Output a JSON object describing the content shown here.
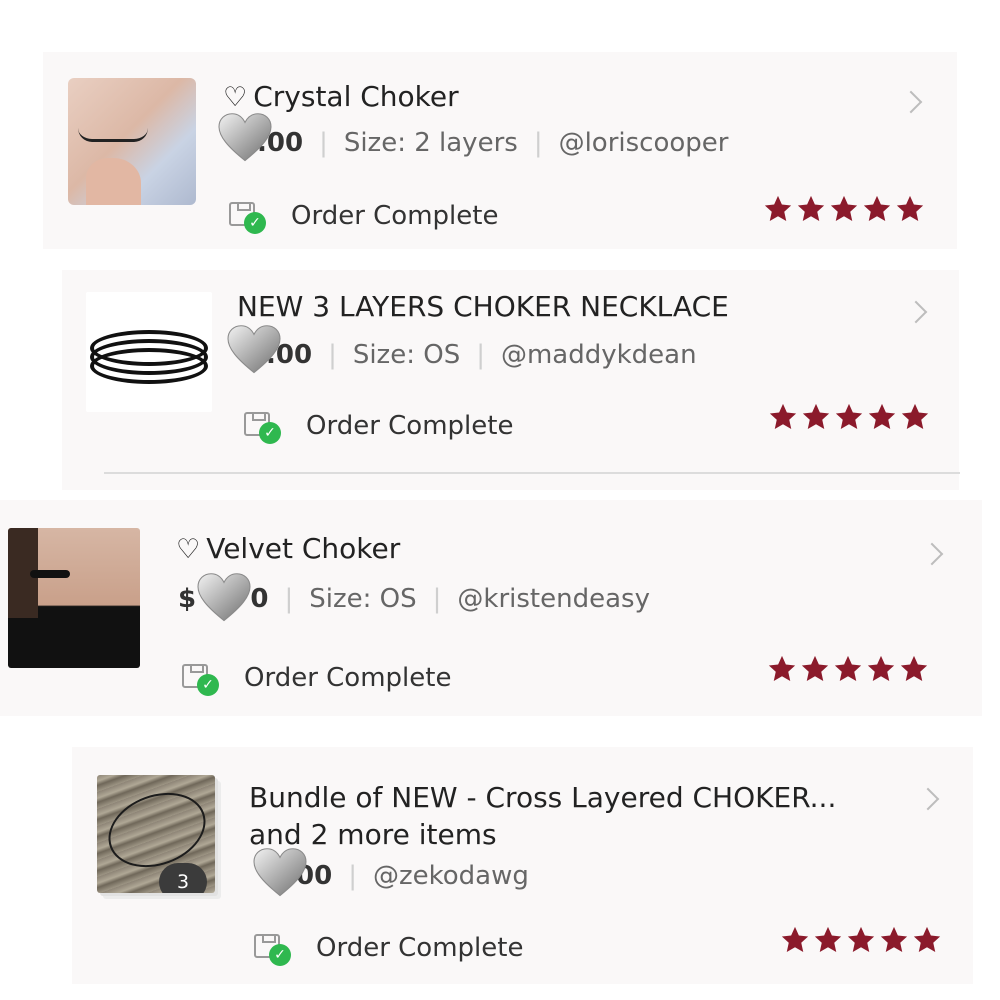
{
  "colors": {
    "star": "#8b1a2b",
    "check": "#2fb84f",
    "card_bg": "#faf8f8"
  },
  "orders": [
    {
      "title": "Crystal Choker",
      "has_heart_outline": true,
      "price_visible": ".00",
      "size": "Size: 2 layers",
      "seller": "@loriscooper",
      "status": "Order Complete",
      "rating": 5
    },
    {
      "title": "NEW 3 LAYERS CHOKER NECKLACE",
      "has_heart_outline": false,
      "price_visible": ".00",
      "size": "Size: OS",
      "seller": "@maddykdean",
      "status": "Order Complete",
      "rating": 5
    },
    {
      "title": "Velvet Choker",
      "has_heart_outline": true,
      "price_visible": "$      0",
      "size": "Size: OS",
      "seller": "@kristendeasy",
      "status": "Order Complete",
      "rating": 5
    },
    {
      "title_line1": "Bundle of NEW - Cross Layered CHOKER...",
      "title_line2": "and 2 more items",
      "has_heart_outline": false,
      "price_visible": "00",
      "seller": "@zekodawg",
      "status": "Order Complete",
      "rating": 5,
      "item_count": "3"
    }
  ],
  "icons": {
    "heart_outline": "♡",
    "check": "✓"
  }
}
